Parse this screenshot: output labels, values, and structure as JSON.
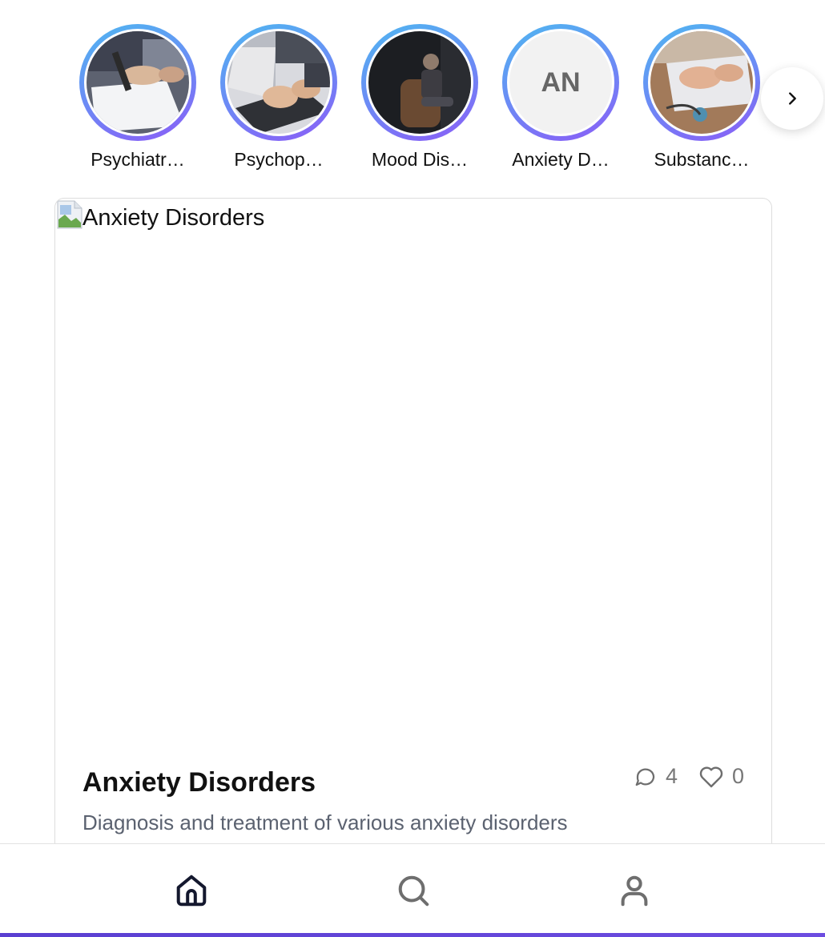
{
  "stories": [
    {
      "label": "Psychiatr…",
      "kind": "photo",
      "photo": "writing-hand-icon"
    },
    {
      "label": "Psychop…",
      "kind": "photo",
      "photo": "laptop-typing-icon"
    },
    {
      "label": "Mood Dis…",
      "kind": "photo",
      "photo": "person-in-dark-icon"
    },
    {
      "label": "Anxiety D…",
      "kind": "initials",
      "initials": "AN"
    },
    {
      "label": "Substanc…",
      "kind": "photo",
      "photo": "laptop-stethoscope-icon"
    }
  ],
  "next_button_icon": "chevron-right-icon",
  "post": {
    "image_alt": "Anxiety Disorders",
    "title": "Anxiety Disorders",
    "description": "Diagnosis and treatment of various anxiety disorders",
    "comments": "4",
    "likes": "0"
  },
  "nav": {
    "items": [
      {
        "icon": "home-icon",
        "active": true
      },
      {
        "icon": "search-icon",
        "active": false
      },
      {
        "icon": "user-icon",
        "active": false
      }
    ]
  },
  "colors": {
    "ring_start": "#4fb7f0",
    "ring_end": "#8b5cf6",
    "nav_active": "#14182e",
    "nav_inactive": "#6e6e6e",
    "accent_bar": "#5a3fd1"
  }
}
